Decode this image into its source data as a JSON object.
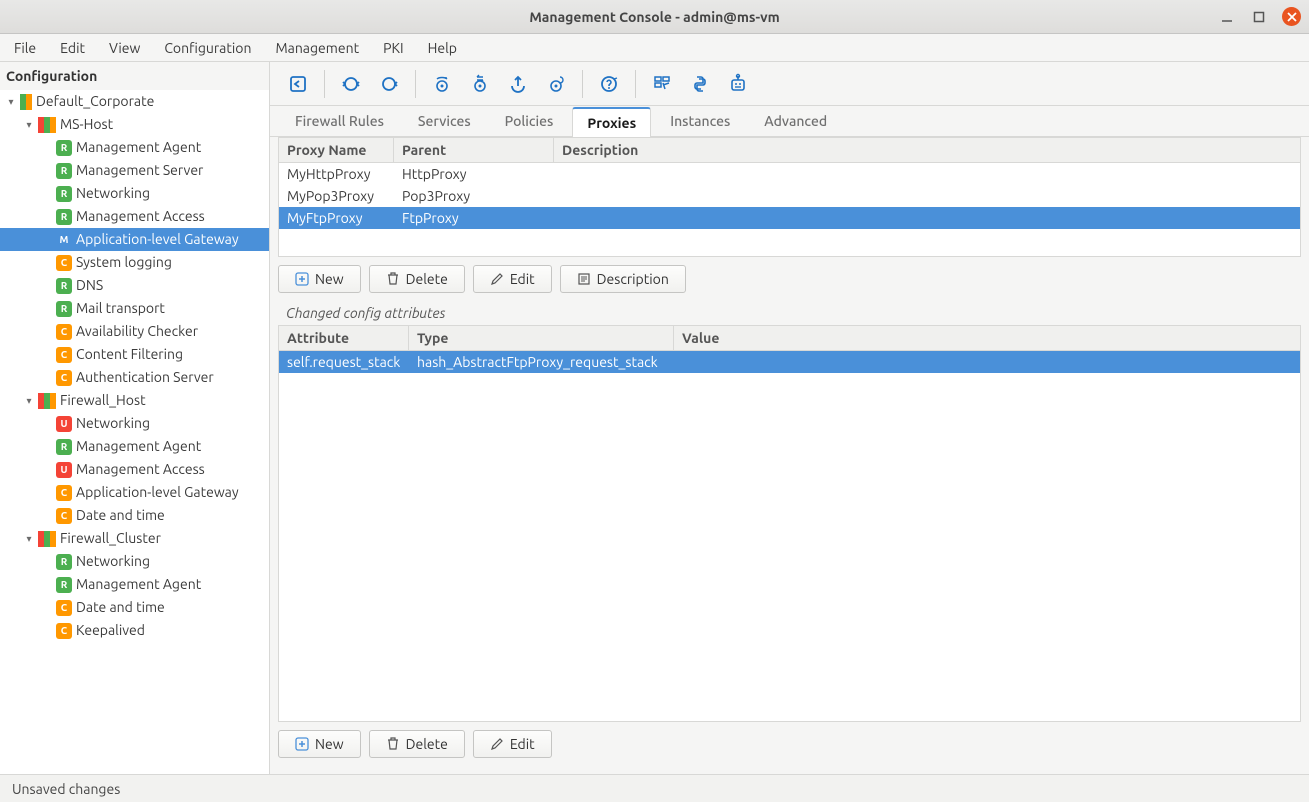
{
  "window": {
    "title": "Management Console - admin@ms-vm"
  },
  "menu": [
    "File",
    "Edit",
    "View",
    "Configuration",
    "Management",
    "PKI",
    "Help"
  ],
  "sidebar": {
    "title": "Configuration",
    "tree": [
      {
        "depth": 0,
        "expand": "down",
        "icon": "host-go",
        "label": "Default_Corporate"
      },
      {
        "depth": 1,
        "expand": "down",
        "icon": "host-rgo",
        "label": "MS-Host"
      },
      {
        "depth": 2,
        "expand": "",
        "icon": "R",
        "label": "Management Agent"
      },
      {
        "depth": 2,
        "expand": "",
        "icon": "R",
        "label": "Management Server"
      },
      {
        "depth": 2,
        "expand": "",
        "icon": "R",
        "label": "Networking"
      },
      {
        "depth": 2,
        "expand": "",
        "icon": "R",
        "label": "Management Access"
      },
      {
        "depth": 2,
        "expand": "",
        "icon": "M",
        "label": "Application-level Gateway",
        "selected": true
      },
      {
        "depth": 2,
        "expand": "",
        "icon": "C",
        "label": "System logging"
      },
      {
        "depth": 2,
        "expand": "",
        "icon": "R",
        "label": "DNS"
      },
      {
        "depth": 2,
        "expand": "",
        "icon": "R",
        "label": "Mail transport"
      },
      {
        "depth": 2,
        "expand": "",
        "icon": "C",
        "label": "Availability Checker"
      },
      {
        "depth": 2,
        "expand": "",
        "icon": "C",
        "label": "Content Filtering"
      },
      {
        "depth": 2,
        "expand": "",
        "icon": "C",
        "label": "Authentication Server"
      },
      {
        "depth": 1,
        "expand": "down",
        "icon": "host-rgo",
        "label": "Firewall_Host"
      },
      {
        "depth": 2,
        "expand": "",
        "icon": "U",
        "label": "Networking"
      },
      {
        "depth": 2,
        "expand": "",
        "icon": "R",
        "label": "Management Agent"
      },
      {
        "depth": 2,
        "expand": "",
        "icon": "U",
        "label": "Management Access"
      },
      {
        "depth": 2,
        "expand": "",
        "icon": "C",
        "label": "Application-level Gateway"
      },
      {
        "depth": 2,
        "expand": "",
        "icon": "C",
        "label": "Date and time"
      },
      {
        "depth": 1,
        "expand": "down",
        "icon": "host-rgo",
        "label": "Firewall_Cluster"
      },
      {
        "depth": 2,
        "expand": "",
        "icon": "R",
        "label": "Networking"
      },
      {
        "depth": 2,
        "expand": "",
        "icon": "R",
        "label": "Management Agent"
      },
      {
        "depth": 2,
        "expand": "",
        "icon": "C",
        "label": "Date and time"
      },
      {
        "depth": 2,
        "expand": "",
        "icon": "C",
        "label": "Keepalived"
      }
    ]
  },
  "toolbar_icons": [
    "back-icon",
    "sep",
    "refresh-icon",
    "reload-icon",
    "sep",
    "settings-view-icon",
    "settings-swap-icon",
    "upload-icon",
    "settings-process-icon",
    "sep",
    "help-icon",
    "sep",
    "form-icon",
    "python-icon",
    "robot-icon"
  ],
  "tabs": {
    "items": [
      "Firewall Rules",
      "Services",
      "Policies",
      "Proxies",
      "Instances",
      "Advanced"
    ],
    "active": "Proxies"
  },
  "proxy_table": {
    "columns": [
      "Proxy Name",
      "Parent",
      "Description"
    ],
    "rows": [
      {
        "name": "MyHttpProxy",
        "parent": "HttpProxy",
        "desc": ""
      },
      {
        "name": "MyPop3Proxy",
        "parent": "Pop3Proxy",
        "desc": ""
      },
      {
        "name": "MyFtpProxy",
        "parent": "FtpProxy",
        "desc": "",
        "selected": true
      }
    ]
  },
  "buttons_top": {
    "new": "New",
    "delete": "Delete",
    "edit": "Edit",
    "description": "Description"
  },
  "section_label": "Changed config attributes",
  "attr_table": {
    "columns": [
      "Attribute",
      "Type",
      "Value"
    ],
    "rows": [
      {
        "attr": "self.request_stack",
        "type": "hash_AbstractFtpProxy_request_stack",
        "value": "",
        "selected": true
      }
    ]
  },
  "buttons_bottom": {
    "new": "New",
    "delete": "Delete",
    "edit": "Edit"
  },
  "status": {
    "left": "Unsaved changes"
  }
}
